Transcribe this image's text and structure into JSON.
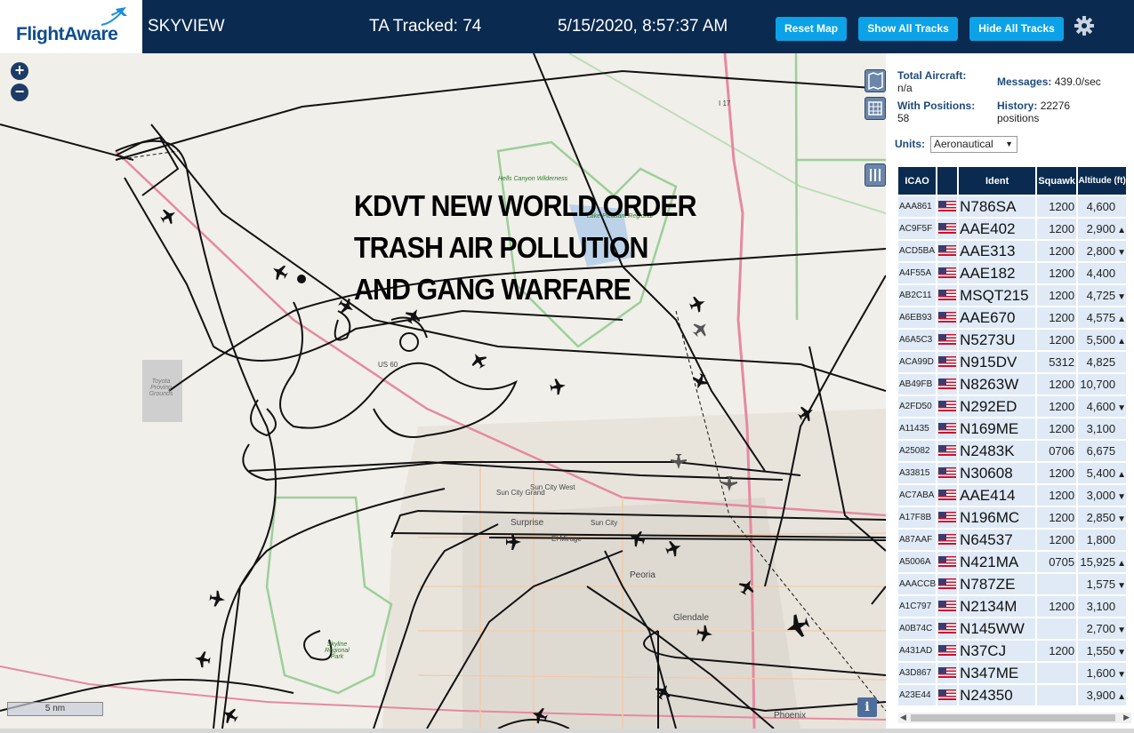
{
  "header": {
    "brand": "FlightAware",
    "title": "SKYVIEW",
    "tracked": "TA Tracked: 74",
    "datetime": "5/15/2020, 8:57:37 AM",
    "reset_label": "Reset Map",
    "show_all_label": "Show All Tracks",
    "hide_all_label": "Hide All Tracks"
  },
  "map": {
    "overlay_lines": [
      "KDVT NEW WORLD ORDER",
      "TRASH AIR POLLUTION",
      "AND GANG WARFARE"
    ],
    "scale": "5 nm",
    "info": "i",
    "labels": {
      "hells_canyon": "Hells Canyon Wilderness",
      "lake_pleasant": "Lake Pleasant Regional",
      "sun_city_grand": "Sun City Grand",
      "sun_city_west": "Sun City West",
      "surprise": "Surprise",
      "sun_city": "Sun City",
      "el_mirage": "El Mirage",
      "peoria": "Peoria",
      "glendale": "Glendale",
      "phoenix": "Phoenix",
      "us60": "US 60",
      "i17": "I 17",
      "toyota": "Toyota Proving Grounds",
      "white_tank": "Skyline Regional Park"
    }
  },
  "panel": {
    "total_aircraft_label": "Total Aircraft:",
    "total_aircraft_value": "n/a",
    "messages_label": "Messages:",
    "messages_value": "439.0/sec",
    "with_positions_label": "With Positions:",
    "with_positions_value": "58",
    "history_label": "History:",
    "history_value": "22276",
    "history_unit": "positions",
    "units_label": "Units:",
    "units_value": "Aeronautical",
    "columns": [
      "ICAO",
      "",
      "Ident",
      "Squawk",
      "Altitude (ft)"
    ],
    "rows": [
      {
        "icao": "AAA861",
        "ident": "N786SA",
        "squawk": "1200",
        "alt": "4,600",
        "trend": ""
      },
      {
        "icao": "AC9F5F",
        "ident": "AAE402",
        "squawk": "1200",
        "alt": "2,900",
        "trend": "▲"
      },
      {
        "icao": "ACD5BA",
        "ident": "AAE313",
        "squawk": "1200",
        "alt": "2,800",
        "trend": "▼"
      },
      {
        "icao": "A4F55A",
        "ident": "AAE182",
        "squawk": "1200",
        "alt": "4,400",
        "trend": ""
      },
      {
        "icao": "AB2C11",
        "ident": "MSQT215",
        "squawk": "1200",
        "alt": "4,725",
        "trend": "▼"
      },
      {
        "icao": "A6EB93",
        "ident": "AAE670",
        "squawk": "1200",
        "alt": "4,575",
        "trend": "▲"
      },
      {
        "icao": "A6A5C3",
        "ident": "N5273U",
        "squawk": "1200",
        "alt": "5,500",
        "trend": "▲"
      },
      {
        "icao": "ACA99D",
        "ident": "N915DV",
        "squawk": "5312",
        "alt": "4,825",
        "trend": ""
      },
      {
        "icao": "AB49FB",
        "ident": "N8263W",
        "squawk": "1200",
        "alt": "10,700",
        "trend": ""
      },
      {
        "icao": "A2FD50",
        "ident": "N292ED",
        "squawk": "1200",
        "alt": "4,600",
        "trend": "▼"
      },
      {
        "icao": "A11435",
        "ident": "N169ME",
        "squawk": "1200",
        "alt": "3,100",
        "trend": ""
      },
      {
        "icao": "A25082",
        "ident": "N2483K",
        "squawk": "0706",
        "alt": "6,675",
        "trend": ""
      },
      {
        "icao": "A33815",
        "ident": "N30608",
        "squawk": "1200",
        "alt": "5,400",
        "trend": "▲"
      },
      {
        "icao": "AC7ABA",
        "ident": "AAE414",
        "squawk": "1200",
        "alt": "3,000",
        "trend": "▼"
      },
      {
        "icao": "A17F8B",
        "ident": "N196MC",
        "squawk": "1200",
        "alt": "2,850",
        "trend": "▼"
      },
      {
        "icao": "A87AAF",
        "ident": "N64537",
        "squawk": "1200",
        "alt": "1,800",
        "trend": ""
      },
      {
        "icao": "A5006A",
        "ident": "N421MA",
        "squawk": "0705",
        "alt": "15,925",
        "trend": "▲"
      },
      {
        "icao": "AAACCB",
        "ident": "N787ZE",
        "squawk": "",
        "alt": "1,575",
        "trend": "▼"
      },
      {
        "icao": "A1C797",
        "ident": "N2134M",
        "squawk": "1200",
        "alt": "3,100",
        "trend": ""
      },
      {
        "icao": "A0B74C",
        "ident": "N145WW",
        "squawk": "",
        "alt": "2,700",
        "trend": "▼"
      },
      {
        "icao": "A431AD",
        "ident": "N37CJ",
        "squawk": "1200",
        "alt": "1,550",
        "trend": "▼"
      },
      {
        "icao": "A3D867",
        "ident": "N347ME",
        "squawk": "",
        "alt": "1,600",
        "trend": "▼"
      },
      {
        "icao": "A23E44",
        "ident": "N24350",
        "squawk": "",
        "alt": "3,900",
        "trend": "▲"
      }
    ]
  }
}
